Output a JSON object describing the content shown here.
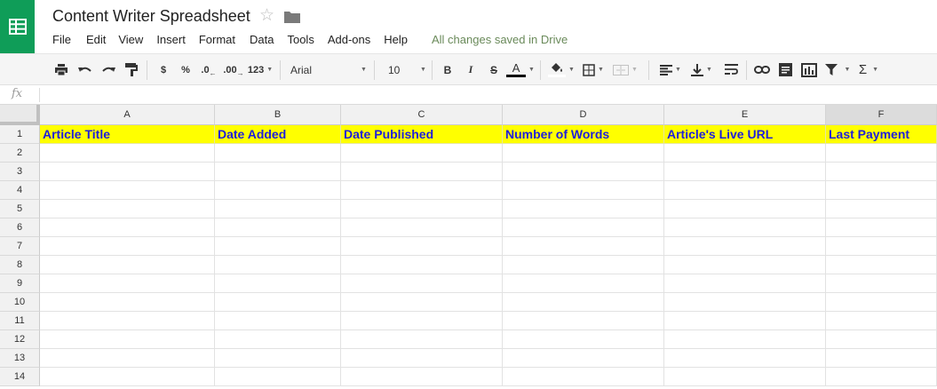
{
  "app": {
    "title": "Content Writer Spreadsheet",
    "save_status": "All changes saved in Drive",
    "brand_color": "#0f9d58"
  },
  "menu": [
    "File",
    "Edit",
    "View",
    "Insert",
    "Format",
    "Data",
    "Tools",
    "Add-ons",
    "Help"
  ],
  "toolbar": {
    "currency_label": "$",
    "percent_label": "%",
    "decrease_decimal_label": ".0",
    "increase_decimal_label": ".00",
    "more_formats_label": "123",
    "font_family": "Arial",
    "font_size": "10",
    "bold_label": "B",
    "italic_label": "I",
    "strikethrough_label": "S",
    "text_color_label": "A",
    "sum_label": "Σ"
  },
  "formula_bar": {
    "fx_label": "fx",
    "value": ""
  },
  "sheet": {
    "columns": [
      "A",
      "B",
      "C",
      "D",
      "E",
      "F"
    ],
    "selected_column": "F",
    "rows": [
      "1",
      "2",
      "3",
      "4",
      "5",
      "6",
      "7",
      "8",
      "9",
      "10",
      "11",
      "12",
      "13",
      "14"
    ],
    "header_row": [
      "Article Title",
      "Date Added",
      "Date Published",
      "Number of Words",
      "Article's Live URL",
      "Last Payment"
    ],
    "header_fill_color": "#ffff00",
    "header_text_color": "#1e1edc"
  }
}
